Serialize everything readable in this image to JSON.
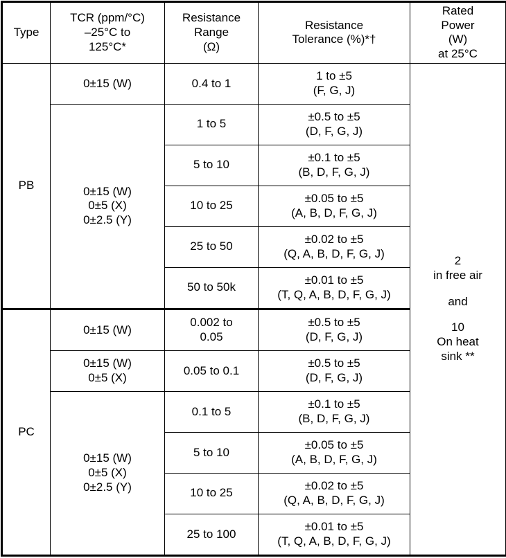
{
  "table": {
    "columns": [
      {
        "key": "type",
        "label": "Type"
      },
      {
        "key": "tcr",
        "label": "TCR (ppm/°C)\n–25°C to\n125°C*"
      },
      {
        "key": "range",
        "label": "Resistance\nRange\n(Ω)"
      },
      {
        "key": "tolerance",
        "label": "Resistance\nTolerance (%)*†"
      },
      {
        "key": "power",
        "label": "Rated\nPower\n(W)\nat 25°C"
      }
    ],
    "header": {
      "type": "Type",
      "tcr_line1": "TCR (ppm/°C)",
      "tcr_line2": "–25°C to",
      "tcr_line3": "125°C*",
      "range_line1": "Resistance",
      "range_line2": "Range",
      "range_line3": "(Ω)",
      "tolerance_line1": "Resistance",
      "tolerance_line2": "Tolerance (%)*†",
      "power_line1": "Rated",
      "power_line2": "Power",
      "power_line3": "(W)",
      "power_line4": "at 25°C"
    },
    "rated_power": {
      "value_1": "2",
      "condition_1": "in free air",
      "conjunction": "and",
      "value_2": "10",
      "condition_2a": "On heat",
      "condition_2b": "sink **"
    },
    "sections": [
      {
        "type": "PB",
        "tcr_groups": [
          {
            "rowspan": 1,
            "lines": [
              "0±15 (W)"
            ]
          },
          {
            "rowspan": 5,
            "lines": [
              "0±15 (W)",
              "0±5 (X)",
              "0±2.5 (Y)"
            ]
          }
        ],
        "rows": [
          {
            "range": [
              "0.4 to 1"
            ],
            "tol_value": "1 to ±5",
            "tol_codes": "(F, G, J)"
          },
          {
            "range": [
              "1 to 5"
            ],
            "tol_value": "±0.5 to ±5",
            "tol_codes": "(D, F, G, J)"
          },
          {
            "range": [
              "5 to 10"
            ],
            "tol_value": "±0.1 to ±5",
            "tol_codes": "(B, D, F, G, J)"
          },
          {
            "range": [
              "10 to 25"
            ],
            "tol_value": "±0.05 to ±5",
            "tol_codes": "(A, B, D, F, G, J)"
          },
          {
            "range": [
              "25 to 50"
            ],
            "tol_value": "±0.02 to ±5",
            "tol_codes": "(Q, A, B, D, F, G, J)"
          },
          {
            "range": [
              "50 to 50k"
            ],
            "tol_value": "±0.01 to ±5",
            "tol_codes": "(T, Q, A, B, D, F, G, J)"
          }
        ]
      },
      {
        "type": "PC",
        "tcr_groups": [
          {
            "rowspan": 1,
            "lines": [
              "0±15 (W)"
            ]
          },
          {
            "rowspan": 1,
            "lines": [
              "0±15 (W)",
              "0±5 (X)"
            ]
          },
          {
            "rowspan": 4,
            "lines": [
              "0±15 (W)",
              "0±5 (X)",
              "0±2.5 (Y)"
            ]
          }
        ],
        "rows": [
          {
            "range": [
              "0.002 to",
              "0.05"
            ],
            "tol_value": "±0.5 to ±5",
            "tol_codes": "(D, F, G, J)"
          },
          {
            "range": [
              "0.05 to 0.1"
            ],
            "tol_value": "±0.5 to ±5",
            "tol_codes": "(D, F, G, J)"
          },
          {
            "range": [
              "0.1 to 5"
            ],
            "tol_value": "±0.1 to ±5",
            "tol_codes": "(B, D, F, G, J)"
          },
          {
            "range": [
              "5 to 10"
            ],
            "tol_value": "±0.05 to ±5",
            "tol_codes": "(A, B, D, F, G, J)"
          },
          {
            "range": [
              "10 to 25"
            ],
            "tol_value": "±0.02 to ±5",
            "tol_codes": "(Q, A, B, D, F, G, J)"
          },
          {
            "range": [
              "25 to 100"
            ],
            "tol_value": "±0.01 to ±5",
            "tol_codes": "(T, Q, A, B, D, F, G, J)"
          }
        ]
      }
    ]
  },
  "colors": {
    "border": "#000000",
    "text": "#000000",
    "background": "#ffffff"
  }
}
